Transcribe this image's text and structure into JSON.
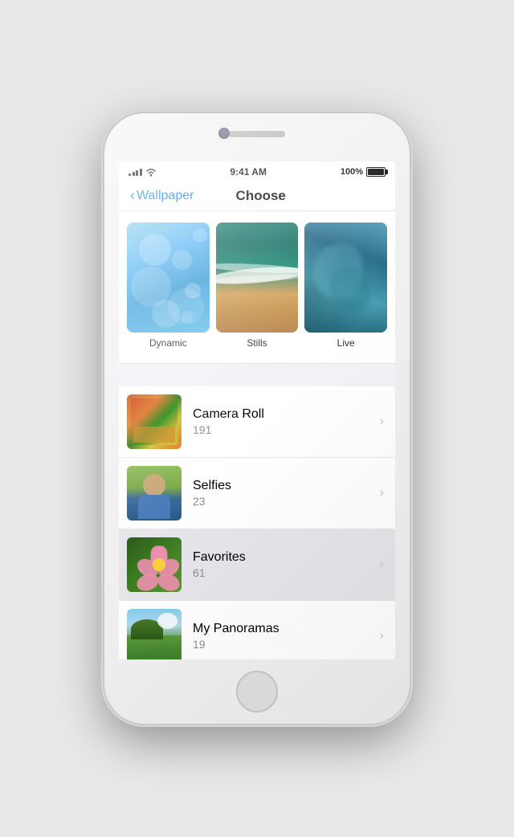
{
  "status": {
    "time": "9:41 AM",
    "battery_percent": "100%",
    "signal_bars": [
      3,
      6,
      9,
      12,
      15
    ],
    "wifi": true
  },
  "nav": {
    "back_label": "Wallpaper",
    "title": "Choose"
  },
  "wallpaper_categories": [
    {
      "id": "dynamic",
      "label": "Dynamic"
    },
    {
      "id": "stills",
      "label": "Stills"
    },
    {
      "id": "live",
      "label": "Live"
    }
  ],
  "albums": [
    {
      "id": "camera-roll",
      "name": "Camera Roll",
      "count": "191"
    },
    {
      "id": "selfies",
      "name": "Selfies",
      "count": "23"
    },
    {
      "id": "favorites",
      "name": "Favorites",
      "count": "61",
      "highlighted": true
    },
    {
      "id": "my-panoramas",
      "name": "My Panoramas",
      "count": "19"
    }
  ]
}
